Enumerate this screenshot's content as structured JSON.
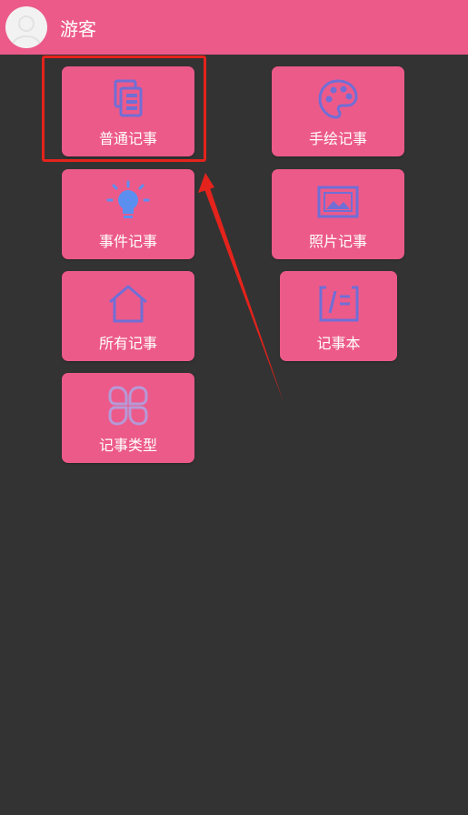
{
  "header": {
    "user_name": "游客",
    "avatar_icon": "default-avatar-icon"
  },
  "menu": [
    {
      "label": "普通记事",
      "icon": "note-copy-icon"
    },
    {
      "label": "手绘记事",
      "icon": "palette-icon"
    },
    {
      "label": "事件记事",
      "icon": "lightbulb-icon"
    },
    {
      "label": "照片记事",
      "icon": "image-icon"
    },
    {
      "label": "所有记事",
      "icon": "home-icon"
    },
    {
      "label": "记事本",
      "icon": "notebook-icon"
    },
    {
      "label": "记事类型",
      "icon": "category-icon"
    }
  ],
  "colors": {
    "header": "#ec5a8a",
    "tile": "#ec5a8a",
    "background": "#333333",
    "icon": "#6f6fd6",
    "highlight": "#e4231c"
  }
}
